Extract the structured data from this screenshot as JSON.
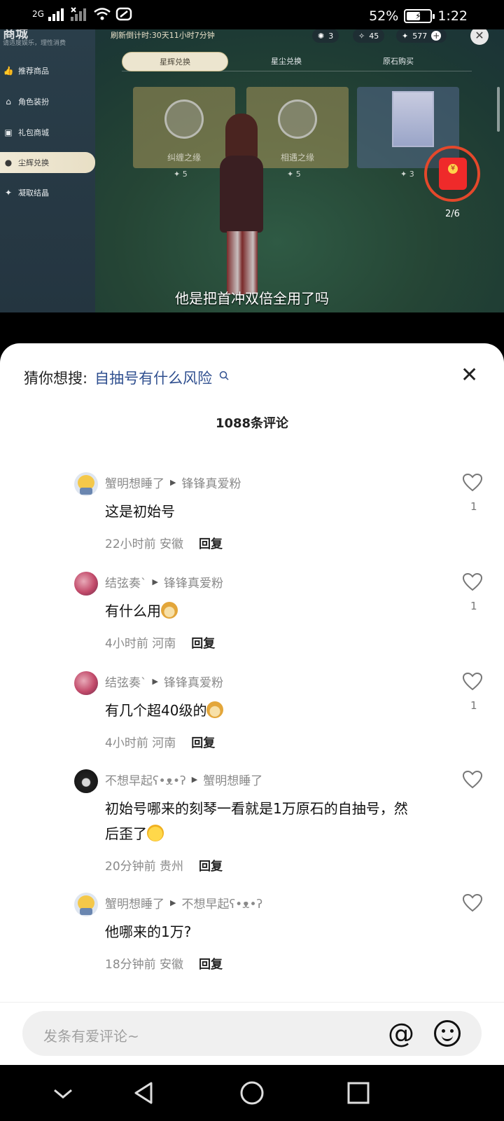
{
  "status_bar": {
    "network_1": "2G",
    "battery_percent": "52%",
    "time": "1:22"
  },
  "game": {
    "shop_title": "商城",
    "shop_subtitle": "请适度娱乐，理性消费",
    "sidebar": [
      {
        "label": "推荐商品",
        "icon": "thumbs-up-icon",
        "active": false
      },
      {
        "label": "角色装扮",
        "icon": "hanger-icon",
        "active": false
      },
      {
        "label": "礼包商城",
        "icon": "gift-icon",
        "active": false
      },
      {
        "label": "尘辉兑换",
        "icon": "bag-icon",
        "active": true
      },
      {
        "label": "凝取结晶",
        "icon": "crystal-icon",
        "active": false
      }
    ],
    "refresh_countdown": "刷新倒计时:30天11小时7分钟",
    "currencies": [
      "3",
      "45",
      "577"
    ],
    "tabs": [
      {
        "label": "星辉兑换",
        "active": true
      },
      {
        "label": "星尘兑换",
        "active": false
      },
      {
        "label": "原石购买",
        "active": false
      }
    ],
    "cards": [
      {
        "label": "纠缠之缘",
        "cost": "5"
      },
      {
        "label": "相遇之缘",
        "cost": "5"
      },
      {
        "label": "",
        "cost": "3"
      }
    ],
    "red_packet_count": "2/6",
    "subtitle": "他是把首冲双倍全用了吗"
  },
  "sheet": {
    "guess_label": "猜你想搜:",
    "guess_query": "自抽号有什么风险",
    "comment_count": "1088条评论",
    "comments": [
      {
        "author": "蟹明想睡了",
        "reply_to": "锋锋真爱粉",
        "text": "这是初始号",
        "emoji": "",
        "time": "22小时前",
        "location": "安徽",
        "reply": "回复",
        "likes": "1",
        "avatar": "cat"
      },
      {
        "author": "结弦奏`",
        "reply_to": "锋锋真爱粉",
        "text": "有什么用",
        "emoji": "doge",
        "time": "4小时前",
        "location": "河南",
        "reply": "回复",
        "likes": "1",
        "avatar": "red"
      },
      {
        "author": "结弦奏`",
        "reply_to": "锋锋真爱粉",
        "text": "有几个超40级的",
        "emoji": "doge",
        "time": "4小时前",
        "location": "河南",
        "reply": "回复",
        "likes": "1",
        "avatar": "red"
      },
      {
        "author": "不想早起ʕ•ᴥ•ʔ",
        "reply_to": "蟹明想睡了",
        "text": "初始号哪来的刻琴一看就是1万原石的自抽号，然后歪了",
        "emoji": "cry",
        "time": "20分钟前",
        "location": "贵州",
        "reply": "回复",
        "likes": "",
        "avatar": "dark"
      },
      {
        "author": "蟹明想睡了",
        "reply_to": "不想早起ʕ•ᴥ•ʔ",
        "text": "他哪来的1万?",
        "emoji": "",
        "time": "18分钟前",
        "location": "安徽",
        "reply": "回复",
        "likes": "",
        "avatar": "cat"
      }
    ],
    "input_placeholder": "发条有爱评论~",
    "at_symbol": "@"
  },
  "colors": {
    "link": "#2f4f8f",
    "red_packet": "#ef2a2a",
    "meta_gray": "#8a8a8a"
  }
}
